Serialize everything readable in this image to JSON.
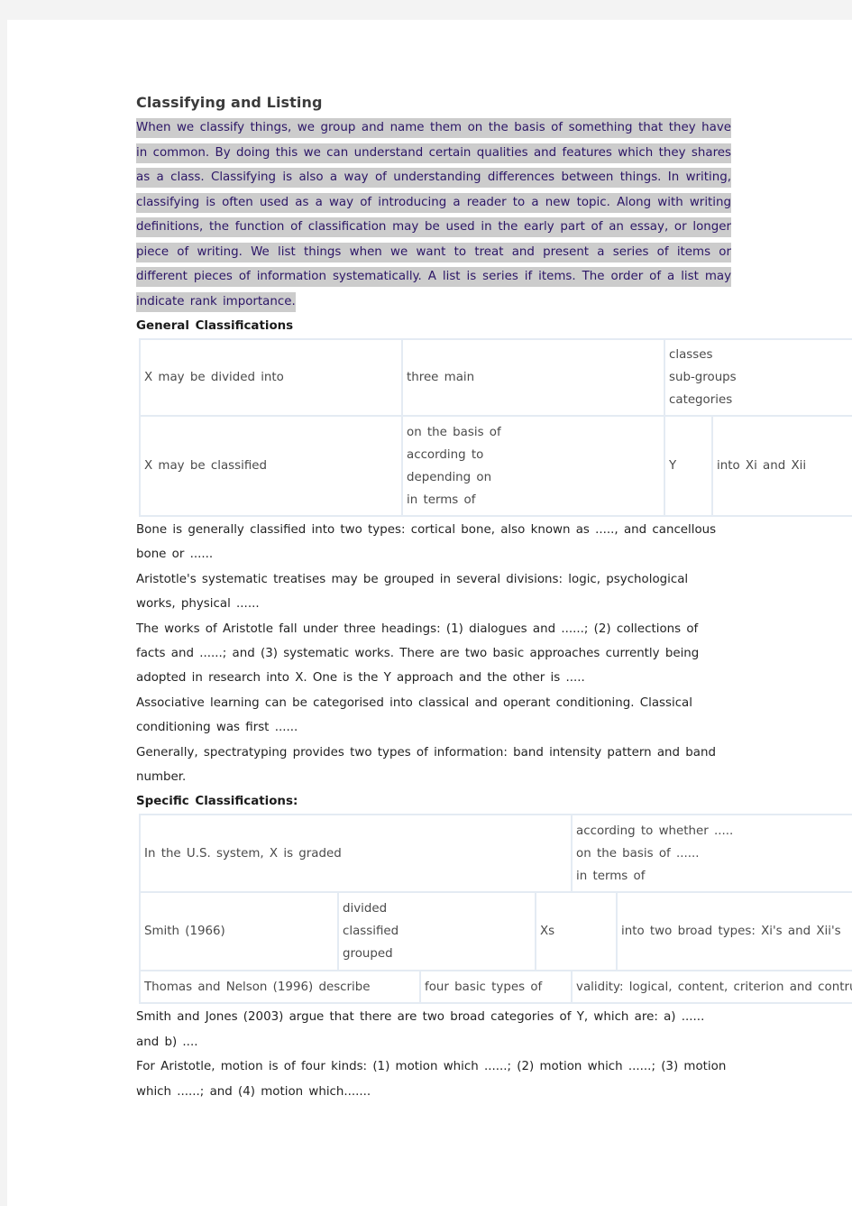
{
  "title": "Classifying and Listing",
  "intro_paragraph": "When we classify things, we group and name them on the basis of something that they have in common. By doing this we can understand certain qualities and features which they shares as a class. Classifying is also a way of understanding differences between things. In writing, classifying is often used as a way of introducing a reader to a new topic. Along with writing definitions, the function of classification may be used in the early part of an essay, or longer piece of writing. We list things when we want to treat and present a series of items or different pieces of information systematically. A list is series if items. The order of a list may indicate rank importance.",
  "general": {
    "heading": "General Classifications",
    "table": {
      "row1": {
        "subject": "X may be divided into",
        "quantity": "three main",
        "options": [
          "classes",
          "sub-groups",
          "categories"
        ]
      },
      "row2": {
        "subject": "X may be classified",
        "basis": [
          "on the basis of",
          "according to",
          "depending on",
          "in terms of"
        ],
        "criterion": "Y",
        "result": "into Xi and Xii"
      }
    },
    "examples": [
      "Bone is generally classified into two types: cortical bone, also known as ....., and cancellous bone or ......",
      "Aristotle's systematic treatises may be grouped in several divisions: logic, psychological works, physical ......",
      "The works of Aristotle fall under three headings: (1) dialogues and ......; (2) collections of facts and ......; and (3) systematic works. There are two basic approaches currently being adopted in research into X. One is the Y approach and the other is .....",
      "Associative learning can be categorised into classical and operant conditioning. Classical conditioning was first ......",
      "Generally, spectratyping provides two types of information: band intensity pattern and band number."
    ]
  },
  "specific": {
    "heading": "Specific Classifications:",
    "table": {
      "row1": {
        "subject": "In the U.S. system, X is graded",
        "basis": [
          "according to whether .....",
          "on the basis of ......",
          "in terms of"
        ]
      },
      "row2": {
        "subject": "Smith (1966)",
        "verbs": [
          "divided",
          "classified",
          "grouped"
        ],
        "object": "Xs",
        "result": "into two broad types: Xi's and Xii's"
      },
      "row3": {
        "subject": "Thomas and Nelson (1996) describe",
        "quantity": "four basic types of",
        "result": "validity: logical, content, criterion and contruct"
      }
    },
    "examples": [
      "Smith and Jones (2003) argue that there are two broad categories of Y, which are: a) ...... and b) ....",
      "For Aristotle, motion is of four kinds: (1) motion which ......; (2) motion which ......; (3) motion which ......; and (4) motion which......."
    ]
  }
}
